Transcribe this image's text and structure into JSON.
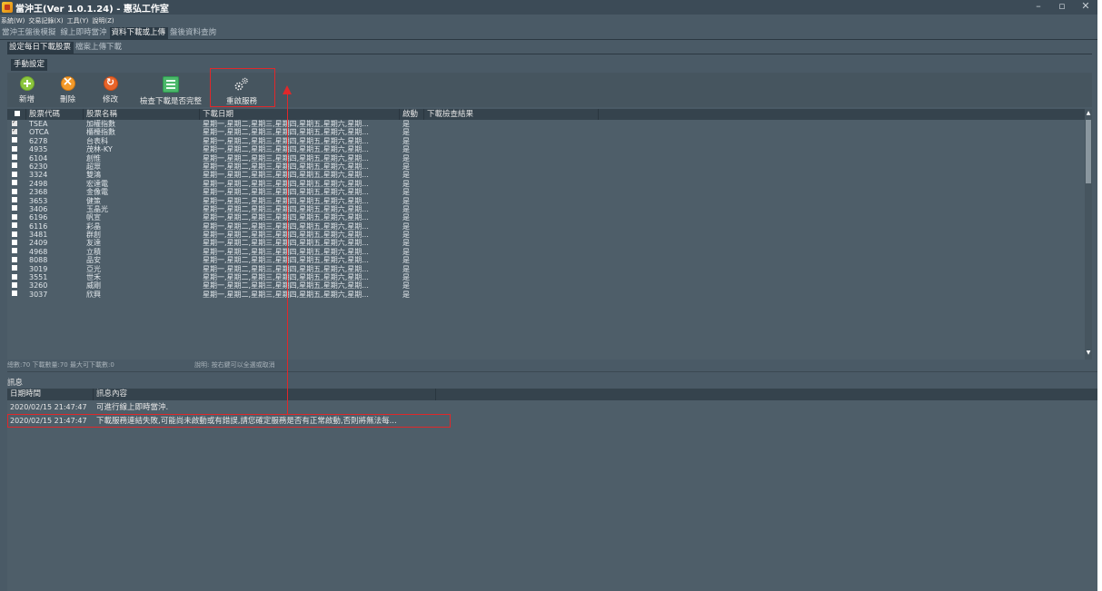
{
  "window": {
    "title": "當沖王(Ver 1.0.1.24) - 惠弘工作室",
    "controls": [
      "–",
      "▫",
      "✕"
    ]
  },
  "menu": [
    "系統(W)",
    "交易記錄(X)",
    "工具(Y)",
    "說明(Z)"
  ],
  "main_tabs": [
    "當沖王盤後模擬",
    "線上即時當沖",
    "資料下載或上傳",
    "盤後資料查詢"
  ],
  "main_tab_active": "資料下載或上傳",
  "sub_tabs": [
    "設定每日下載股票",
    "檔案上傳下載"
  ],
  "sub_tab_active": "設定每日下載股票",
  "group_tab": "手動設定",
  "toolbar": {
    "add_label": "新增",
    "delete_label": "刪除",
    "edit_label": "修改",
    "check_label": "檢查下載是否完整",
    "restart_label": "重啟服務"
  },
  "table": {
    "columns": [
      "股票代碼",
      "股票名稱",
      "下載日期",
      "啟動",
      "下載檢查結果"
    ],
    "rows": [
      {
        "checked": true,
        "code": "TSEA",
        "name": "加權指數",
        "days": "星期一,星期二,星期三,星期四,星期五,星期六,星期...",
        "enabled": "是"
      },
      {
        "checked": true,
        "code": "OTCA",
        "name": "櫃檯指數",
        "days": "星期一,星期二,星期三,星期四,星期五,星期六,星期...",
        "enabled": "是"
      },
      {
        "checked": false,
        "code": "6278",
        "name": "台表科",
        "days": "星期一,星期二,星期三,星期四,星期五,星期六,星期...",
        "enabled": "是"
      },
      {
        "checked": false,
        "code": "4935",
        "name": "茂林-KY",
        "days": "星期一,星期二,星期三,星期四,星期五,星期六,星期...",
        "enabled": "是"
      },
      {
        "checked": false,
        "code": "6104",
        "name": "創惟",
        "days": "星期一,星期二,星期三,星期四,星期五,星期六,星期...",
        "enabled": "是"
      },
      {
        "checked": false,
        "code": "6230",
        "name": "超眾",
        "days": "星期一,星期二,星期三,星期四,星期五,星期六,星期...",
        "enabled": "是"
      },
      {
        "checked": false,
        "code": "3324",
        "name": "雙鴻",
        "days": "星期一,星期二,星期三,星期四,星期五,星期六,星期...",
        "enabled": "是"
      },
      {
        "checked": false,
        "code": "2498",
        "name": "宏達電",
        "days": "星期一,星期二,星期三,星期四,星期五,星期六,星期...",
        "enabled": "是"
      },
      {
        "checked": false,
        "code": "2368",
        "name": "金像電",
        "days": "星期一,星期二,星期三,星期四,星期五,星期六,星期...",
        "enabled": "是"
      },
      {
        "checked": false,
        "code": "3653",
        "name": "健策",
        "days": "星期一,星期二,星期三,星期四,星期五,星期六,星期...",
        "enabled": "是"
      },
      {
        "checked": false,
        "code": "3406",
        "name": "玉晶光",
        "days": "星期一,星期二,星期三,星期四,星期五,星期六,星期...",
        "enabled": "是"
      },
      {
        "checked": false,
        "code": "6196",
        "name": "帆宣",
        "days": "星期一,星期二,星期三,星期四,星期五,星期六,星期...",
        "enabled": "是"
      },
      {
        "checked": false,
        "code": "6116",
        "name": "彩晶",
        "days": "星期一,星期二,星期三,星期四,星期五,星期六,星期...",
        "enabled": "是"
      },
      {
        "checked": false,
        "code": "3481",
        "name": "群創",
        "days": "星期一,星期二,星期三,星期四,星期五,星期六,星期...",
        "enabled": "是"
      },
      {
        "checked": false,
        "code": "2409",
        "name": "友達",
        "days": "星期一,星期二,星期三,星期四,星期五,星期六,星期...",
        "enabled": "是"
      },
      {
        "checked": false,
        "code": "4968",
        "name": "立積",
        "days": "星期一,星期二,星期三,星期四,星期五,星期六,星期...",
        "enabled": "是"
      },
      {
        "checked": false,
        "code": "8088",
        "name": "品安",
        "days": "星期一,星期二,星期三,星期四,星期五,星期六,星期...",
        "enabled": "是"
      },
      {
        "checked": false,
        "code": "3019",
        "name": "亞光",
        "days": "星期一,星期二,星期三,星期四,星期五,星期六,星期...",
        "enabled": "是"
      },
      {
        "checked": false,
        "code": "3551",
        "name": "世禾",
        "days": "星期一,星期二,星期三,星期四,星期五,星期六,星期...",
        "enabled": "是"
      },
      {
        "checked": false,
        "code": "3260",
        "name": "威剛",
        "days": "星期一,星期二,星期三,星期四,星期五,星期六,星期...",
        "enabled": "是"
      },
      {
        "checked": false,
        "code": "3037",
        "name": "欣興",
        "days": "星期一,星期二,星期三,星期四,星期五,星期六,星期...",
        "enabled": "是"
      }
    ]
  },
  "status": {
    "counts": "總數:70  下載數量:70  最大可下載數:0",
    "hint": "說明: 按右鍵可以全選或取消"
  },
  "messages": {
    "title": "訊息",
    "columns": [
      "日期時間",
      "訊息內容"
    ],
    "rows": [
      {
        "time": "2020/02/15 21:47:47",
        "text": "可進行線上即時當沖."
      },
      {
        "time": "2020/02/15 21:47:47",
        "text": "下載服務連結失敗,可能尚未啟動或有錯誤,請您確定服務是否有正常啟動,否則將無法每..."
      }
    ]
  },
  "colors": {
    "background": "#4a5a66",
    "header": "#35434d",
    "annotation": "#e0282a"
  }
}
